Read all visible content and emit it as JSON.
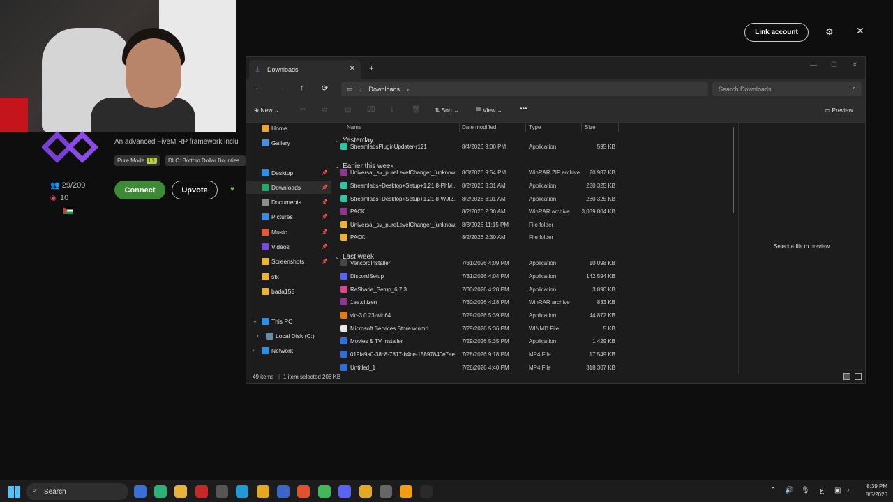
{
  "background_page": {
    "description": "An advanced FiveM RP framework inclu",
    "tags": {
      "pure_mode": "Pure Mode",
      "level": "L1",
      "dlc": "DLC: Bottom Dollar Bounties"
    },
    "players": "29/200",
    "boosts": "10",
    "connect_label": "Connect",
    "upvote_label": "Upvote",
    "link_account_label": "Link account"
  },
  "explorer": {
    "tab_title": "Downloads",
    "breadcrumb": "Downloads",
    "search_placeholder": "Search Downloads",
    "commands": {
      "new": "New",
      "sort": "Sort",
      "view": "View",
      "more": "•••",
      "preview": "Preview"
    },
    "sidebar": [
      {
        "label": "Home",
        "icon": "home-icon",
        "color": "#e8a33a"
      },
      {
        "label": "Gallery",
        "icon": "gallery-icon",
        "color": "#4a90d9"
      },
      {
        "label": "Desktop",
        "icon": "desktop-icon",
        "color": "#2f8fdc",
        "pinned": true
      },
      {
        "label": "Downloads",
        "icon": "download-icon",
        "color": "#28a56a",
        "pinned": true,
        "selected": true
      },
      {
        "label": "Documents",
        "icon": "documents-icon",
        "color": "#8c8c8c",
        "pinned": true
      },
      {
        "label": "Pictures",
        "icon": "pictures-icon",
        "color": "#3a8bd8",
        "pinned": true
      },
      {
        "label": "Music",
        "icon": "music-icon",
        "color": "#e25a3a",
        "pinned": true
      },
      {
        "label": "Videos",
        "icon": "videos-icon",
        "color": "#7a4ad8",
        "pinned": true
      },
      {
        "label": "Screenshots",
        "icon": "folder-icon",
        "color": "#e8b33a",
        "pinned": true
      },
      {
        "label": "sfx",
        "icon": "folder-icon",
        "color": "#e8b33a"
      },
      {
        "label": "bada155",
        "icon": "folder-icon",
        "color": "#e8b33a"
      },
      {
        "label": "This PC",
        "icon": "pc-icon",
        "color": "#2f8fdc"
      },
      {
        "label": "Local Disk (C:)",
        "icon": "disk-icon",
        "color": "#6a8aa8"
      },
      {
        "label": "Network",
        "icon": "network-icon",
        "color": "#2f8fdc"
      }
    ],
    "columns": {
      "name": "Name",
      "date": "Date modified",
      "type": "Type",
      "size": "Size"
    },
    "groups": {
      "yesterday": "Yesterday",
      "earlier": "Earlier this week",
      "last_week": "Last week"
    },
    "files": [
      {
        "name": "StreamlabsPluginUpdater-r121",
        "date": "8/4/2026 9:00 PM",
        "type": "Application",
        "size": "595 KB",
        "icon": "streamlabs-icon",
        "color": "#31c3a2"
      },
      {
        "name": "Universal_sv_pureLevelChanger_[unknow...",
        "date": "8/3/2026 9:54 PM",
        "type": "WinRAR ZIP archive",
        "size": "20,987 KB",
        "icon": "winrar-icon",
        "color": "#8b3a8b"
      },
      {
        "name": "Streamlabs+Desktop+Setup+1.21.8-PhM...",
        "date": "8/2/2026 3:01 AM",
        "type": "Application",
        "size": "280,325 KB",
        "icon": "streamlabs-icon",
        "color": "#31c3a2"
      },
      {
        "name": "Streamlabs+Desktop+Setup+1.21.8-WJI2...",
        "date": "8/2/2026 3:01 AM",
        "type": "Application",
        "size": "280,325 KB",
        "icon": "streamlabs-icon",
        "color": "#31c3a2"
      },
      {
        "name": "PACK",
        "date": "8/2/2026 2:30 AM",
        "type": "WinRAR archive",
        "size": "3,039,804 KB",
        "icon": "winrar-icon",
        "color": "#8b3a8b"
      },
      {
        "name": "Universal_sv_pureLevelChanger_[unknow...",
        "date": "8/3/2026 11:15 PM",
        "type": "File folder",
        "size": "",
        "icon": "folder-icon",
        "color": "#e8b33a"
      },
      {
        "name": "PACK",
        "date": "8/2/2026 2:30 AM",
        "type": "File folder",
        "size": "",
        "icon": "folder-icon",
        "color": "#e8b33a"
      },
      {
        "name": "VencordInstaller",
        "date": "7/31/2026 4:09 PM",
        "type": "Application",
        "size": "10,098 KB",
        "icon": "vencord-icon",
        "color": "#444"
      },
      {
        "name": "DiscordSetup",
        "date": "7/31/2026 4:04 PM",
        "type": "Application",
        "size": "142,594 KB",
        "icon": "discord-icon",
        "color": "#5865f2"
      },
      {
        "name": "ReShade_Setup_6.7.3",
        "date": "7/30/2026 4:20 PM",
        "type": "Application",
        "size": "3,890 KB",
        "icon": "reshade-icon",
        "color": "#d84a8a"
      },
      {
        "name": "1ee.citizen",
        "date": "7/30/2026 4:18 PM",
        "type": "WinRAR archive",
        "size": "833 KB",
        "icon": "winrar-icon",
        "color": "#8b3a8b"
      },
      {
        "name": "vlc-3.0.23-win64",
        "date": "7/29/2026 5:39 PM",
        "type": "Application",
        "size": "44,872 KB",
        "icon": "vlc-icon",
        "color": "#e07b1a"
      },
      {
        "name": "Microsoft.Services.Store.winmd",
        "date": "7/29/2026 5:36 PM",
        "type": "WINMD File",
        "size": "5 KB",
        "icon": "file-icon",
        "color": "#e6e6e6"
      },
      {
        "name": "Movies & TV Installer",
        "date": "7/29/2026 5:35 PM",
        "type": "Application",
        "size": "1,429 KB",
        "icon": "installer-icon",
        "color": "#2f6fdc"
      },
      {
        "name": "019fa9a0-38c8-7817-b4ce-15897840e7ae",
        "date": "7/28/2026 9:18 PM",
        "type": "MP4 File",
        "size": "17,549 KB",
        "icon": "video-file-icon",
        "color": "#2f6fdc"
      },
      {
        "name": "Untitled_1",
        "date": "7/28/2026 4:40 PM",
        "type": "MP4 File",
        "size": "318,307 KB",
        "icon": "video-file-icon",
        "color": "#2f6fdc"
      }
    ],
    "preview_message": "Select a file to preview.",
    "status": {
      "items": "49 items",
      "selected": "1 item selected  206 KB"
    }
  },
  "taskbar": {
    "search_label": "Search",
    "clock_time": "8:39 PM",
    "clock_date": "8/5/2026",
    "lang": "ع",
    "apps": [
      {
        "icon": "snipping-tool-icon",
        "color": "#3b6fd8"
      },
      {
        "icon": "copilot-icon",
        "color": "#2db07a"
      },
      {
        "icon": "file-explorer-icon",
        "color": "#e8b33a"
      },
      {
        "icon": "voice-app-icon",
        "color": "#c62828"
      },
      {
        "icon": "store-icon",
        "color": "#555"
      },
      {
        "icon": "edge-icon",
        "color": "#1f9bd6"
      },
      {
        "icon": "chrome-icon",
        "color": "#e5a821"
      },
      {
        "icon": "vscode-icon",
        "color": "#3a66c8"
      },
      {
        "icon": "brave-icon",
        "color": "#e0532a"
      },
      {
        "icon": "spotify-like-icon",
        "color": "#3fb95a"
      },
      {
        "icon": "discord-icon",
        "color": "#5865f2"
      },
      {
        "icon": "chrome-icon",
        "color": "#e5a821"
      },
      {
        "icon": "steam-icon",
        "color": "#666"
      },
      {
        "icon": "fivem-icon",
        "color": "#f39c12"
      },
      {
        "icon": "nvim-icon",
        "color": "#2a2a2a"
      }
    ]
  }
}
